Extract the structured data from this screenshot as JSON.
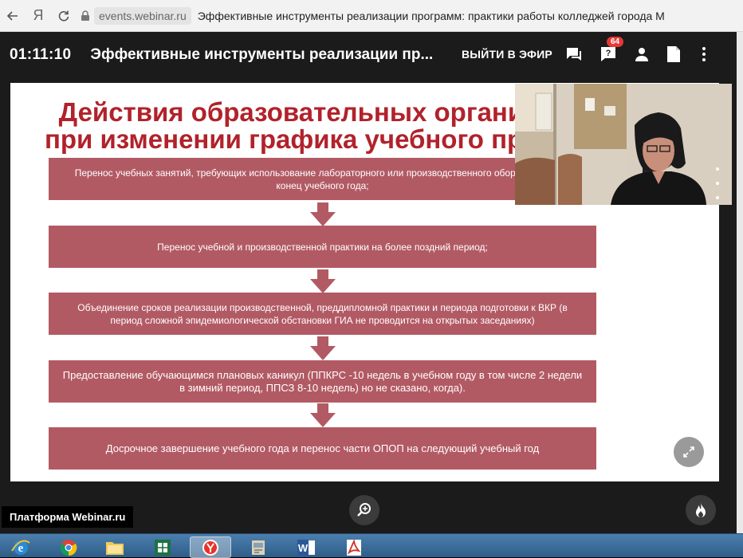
{
  "browser": {
    "url_domain": "events.webinar.ru",
    "page_title": "Эффективные инструменты реализации программ: практики работы колледжей города М",
    "yandex_glyph": "Я"
  },
  "webinar": {
    "timer": "01:11:10",
    "title": "Эффективные инструменты реализации пр...",
    "exit_label": "ВЫЙТИ В ЭФИР",
    "question_count": "64",
    "platform_label": "Платформа Webinar.ru"
  },
  "slide": {
    "title_line1": "Действия образовательных организаций",
    "title_line2": "при изменении графика учебного процесса",
    "steps": [
      "Перенос учебных занятий, требующих использование лабораторного или производственного оборудования на конец учебного года;",
      "Перенос учебной и производственной практики на более поздний период;",
      "Объединение сроков реализации производственной, преддипломной практики и периода подготовки к ВКР (в период сложной эпидемиологической обстановки ГИА не проводится на открытых заседаниях)",
      "Предоставление обучающимся плановых каникул (ППКРС -10 недель в учебном году в том числе 2 недели в зимний период, ППСЗ 8-10 недель) но не сказано, когда).",
      "Досрочное завершение учебного года и перенос части ОПОП на следующий учебный год"
    ]
  },
  "colors": {
    "step_fill": "#b25a64",
    "title_red": "#b1222b",
    "badge_red": "#e53935"
  },
  "icons": [
    "back-arrow-icon",
    "reload-icon",
    "lock-icon",
    "chat-icon",
    "question-icon",
    "user-icon",
    "document-icon",
    "more-vertical-icon",
    "expand-icon",
    "zoom-in-icon",
    "fire-icon"
  ],
  "taskbar": {
    "items": [
      "internet-explorer",
      "chrome",
      "file-explorer",
      "excel",
      "yandex-browser",
      "scanner",
      "word",
      "acrobat"
    ],
    "active_item": "yandex-browser"
  }
}
